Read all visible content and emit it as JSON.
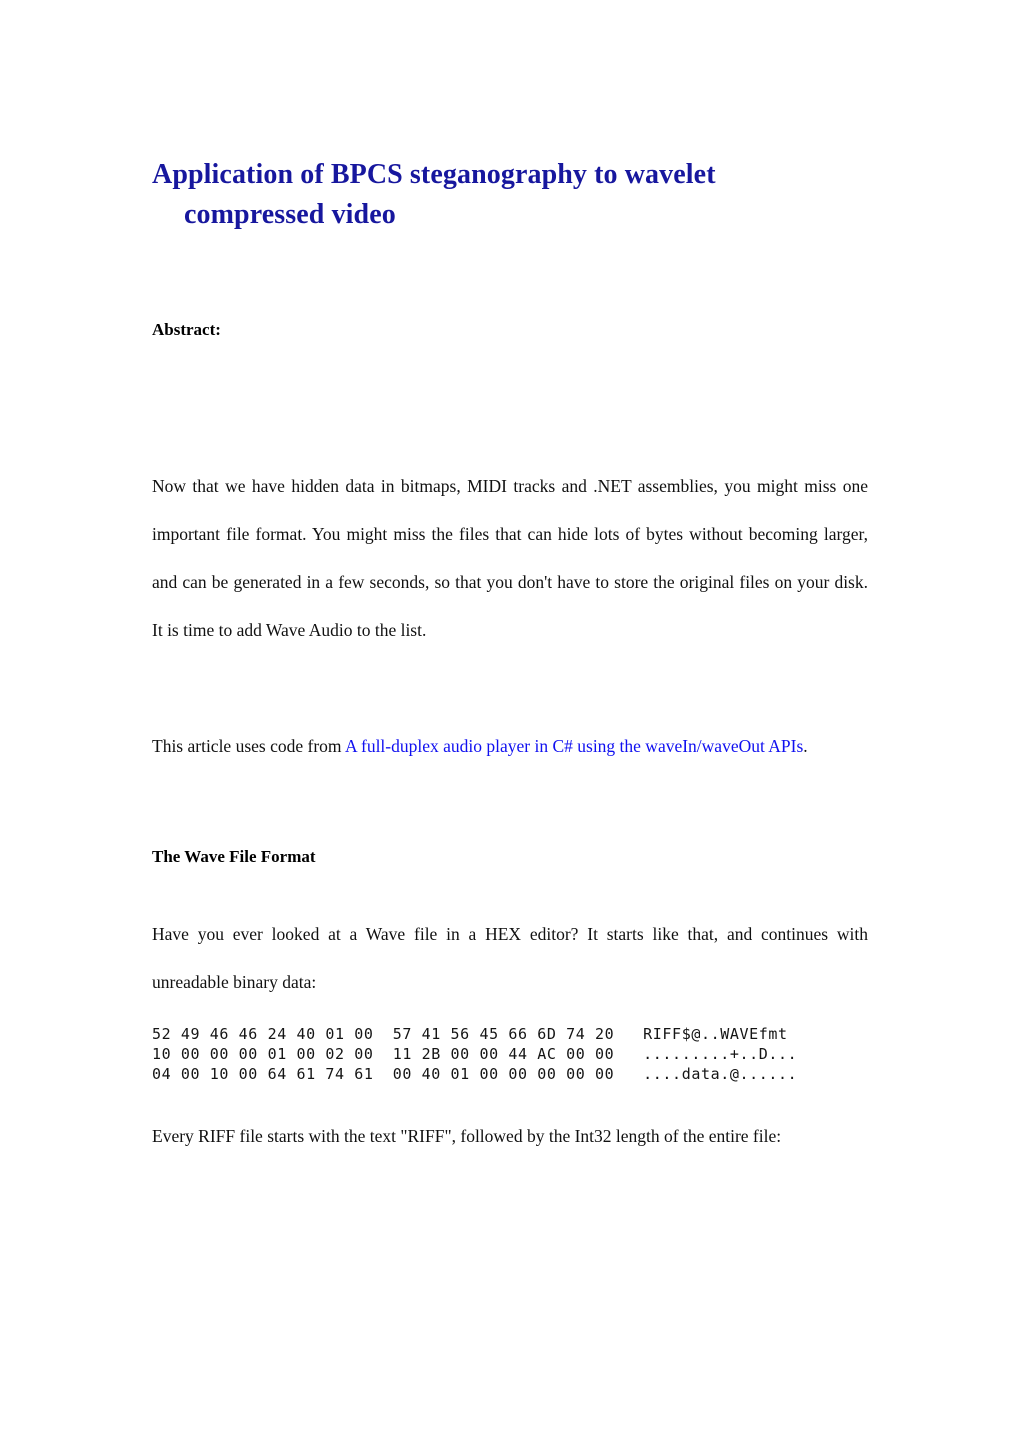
{
  "document": {
    "title_line1": "Application of BPCS steganography to wavelet",
    "title_line2": "compressed video",
    "title_color": "#17179e",
    "link_color": "#1010f0",
    "page_background": "#ffffff"
  },
  "abstract": {
    "heading": "Abstract:"
  },
  "paragraphs": {
    "intro": "Now that we have hidden data in bitmaps, MIDI tracks and .NET assemblies, you might miss one important file format. You might miss the files that can hide lots of bytes without becoming larger, and can be generated in a few seconds, so that you don't have to store the original files on your disk. It is time to add Wave Audio to the list.",
    "credit_prefix": "This article uses code from ",
    "credit_link": "A full-duplex audio player in C# using the waveIn/waveOut APIs",
    "credit_suffix": ".",
    "hex_lead": "Have you ever looked at a Wave file in a HEX editor? It starts like that, and continues with unreadable binary data:",
    "riff_note": "Every RIFF file starts with the text \"RIFF\", followed by the Int32 length of the entire file:"
  },
  "sections": {
    "wave_file_format_heading": "The Wave File Format"
  },
  "hexdump": {
    "rows": [
      "52 49 46 46 24 40 01 00  57 41 56 45 66 6D 74 20   RIFF$@..WAVEfmt ",
      "10 00 00 00 01 00 02 00  11 2B 00 00 44 AC 00 00   .........+..D...",
      "04 00 10 00 64 61 74 61  00 40 01 00 00 00 00 00   ....data.@......"
    ]
  }
}
